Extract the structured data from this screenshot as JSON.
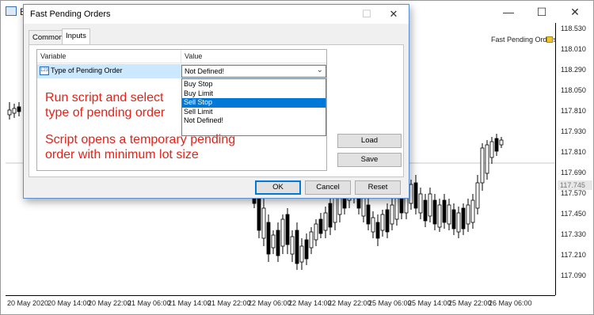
{
  "app": {
    "title": "E",
    "minimize": "—",
    "maximize": "☐",
    "close": "✕"
  },
  "chart": {
    "indicator_label": "Fast Pending Orders",
    "current_price": "117.745",
    "price_labels": [
      "118.530",
      "118.010",
      "118.290",
      "118.050",
      "117.810",
      "117.930",
      "117.810",
      "117.690",
      "117.570",
      "117.450",
      "117.330",
      "117.210",
      "117.090"
    ],
    "time_labels": [
      "20 May 2020",
      "20 May 14:00",
      "20 May 22:00",
      "21 May 06:00",
      "21 May 14:00",
      "21 May 22:00",
      "22 May 06:00",
      "22 May 14:00",
      "22 May 22:00",
      "25 May 06:00",
      "25 May 14:00",
      "25 May 22:00",
      "26 May 06:00"
    ]
  },
  "dialog": {
    "title": "Fast Pending Orders",
    "maximize": "☐",
    "close": "✕",
    "tabs": [
      "Common",
      "Inputs"
    ],
    "active_tab": "Inputs",
    "table": {
      "col_variable": "Variable",
      "col_value": "Value",
      "param_icon": "123",
      "param_name": "Type of Pending Order",
      "param_value": "Not Defined!",
      "options": [
        "Buy Stop",
        "Buy Limit",
        "Sell Stop",
        "Sell Limit",
        "Not Defined!"
      ],
      "highlighted_option": "Sell Stop"
    },
    "notes": {
      "line1": "Run script and select",
      "line2": "type of pending order",
      "line3": "Script opens a temporary pending",
      "line4": "order with minimum lot size"
    },
    "load_label": "Load",
    "save_label": "Save",
    "ok_label": "OK",
    "cancel_label": "Cancel",
    "reset_label": "Reset"
  }
}
